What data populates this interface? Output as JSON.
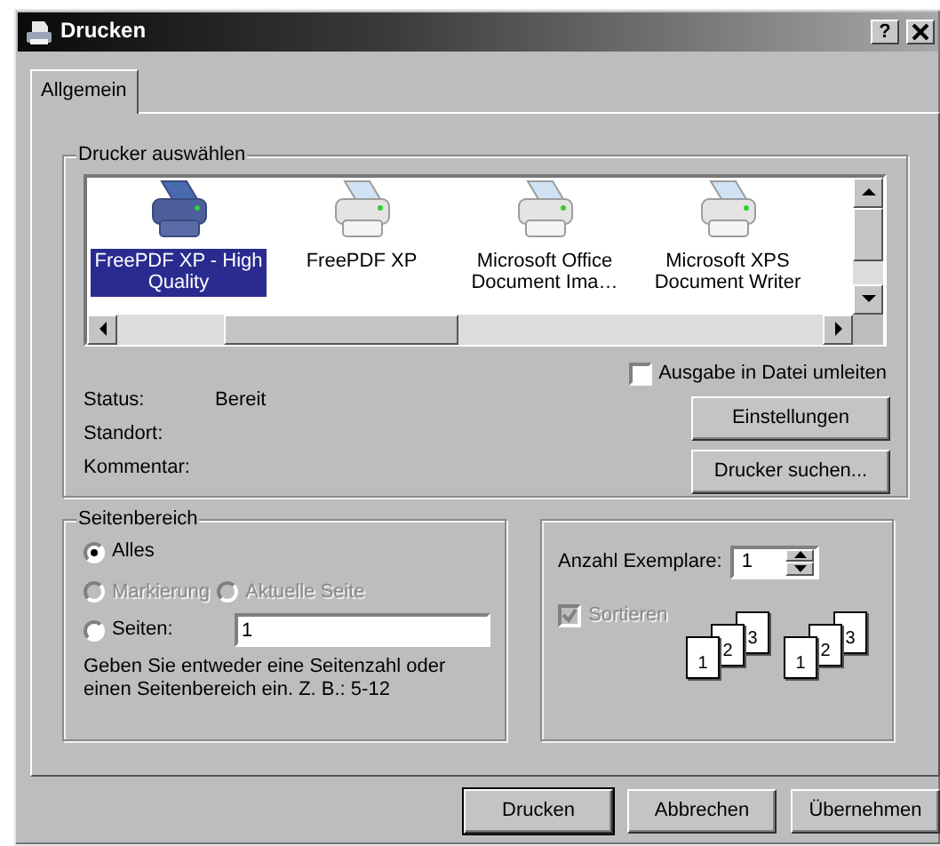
{
  "window": {
    "title": "Drucken",
    "help_button": "?"
  },
  "tabs": [
    {
      "label": "Allgemein",
      "selected": true
    }
  ],
  "printer_group": {
    "title": "Drucker auswählen",
    "printers": [
      {
        "lines": [
          "FreePDF XP - High",
          "Quality"
        ],
        "selected": true
      },
      {
        "lines": [
          "FreePDF XP"
        ],
        "selected": false
      },
      {
        "lines": [
          "Microsoft Office",
          "Document Ima…"
        ],
        "selected": false
      },
      {
        "lines": [
          "Microsoft XPS",
          "Document Writer"
        ],
        "selected": false
      }
    ],
    "print_to_file": {
      "label": "Ausgabe in Datei umleiten",
      "checked": false
    },
    "info": [
      {
        "label": "Status:",
        "value": "Bereit"
      },
      {
        "label": "Standort:"
      },
      {
        "label": "Kommentar:"
      }
    ],
    "buttons": [
      "Einstellungen",
      "Drucker suchen..."
    ]
  },
  "page_range": {
    "title": "Seitenbereich",
    "options": [
      {
        "label": "Alles",
        "selected": true,
        "disabled": false
      },
      {
        "label": "Markierung",
        "selected": false,
        "disabled": true
      },
      {
        "label": "Aktuelle Seite",
        "selected": false,
        "disabled": true
      },
      {
        "label": "Seiten:",
        "selected": false,
        "disabled": false
      }
    ],
    "pages_value": "1",
    "hint": "Geben Sie entweder eine Seitenzahl oder einen Seitenbereich ein. Z. B.: 5-12"
  },
  "copies": {
    "label": "Anzahl Exemplare:",
    "value": "1",
    "collate": {
      "label": "Sortieren",
      "checked": true,
      "disabled": true
    },
    "collate_illustrations": [
      [
        "1",
        "2",
        "3"
      ],
      [
        "1",
        "2",
        "3"
      ]
    ]
  },
  "footer_buttons": [
    {
      "label": "Drucken",
      "default": true
    },
    {
      "label": "Abbrechen",
      "default": false
    },
    {
      "label": "Übernehmen",
      "default": false
    }
  ]
}
